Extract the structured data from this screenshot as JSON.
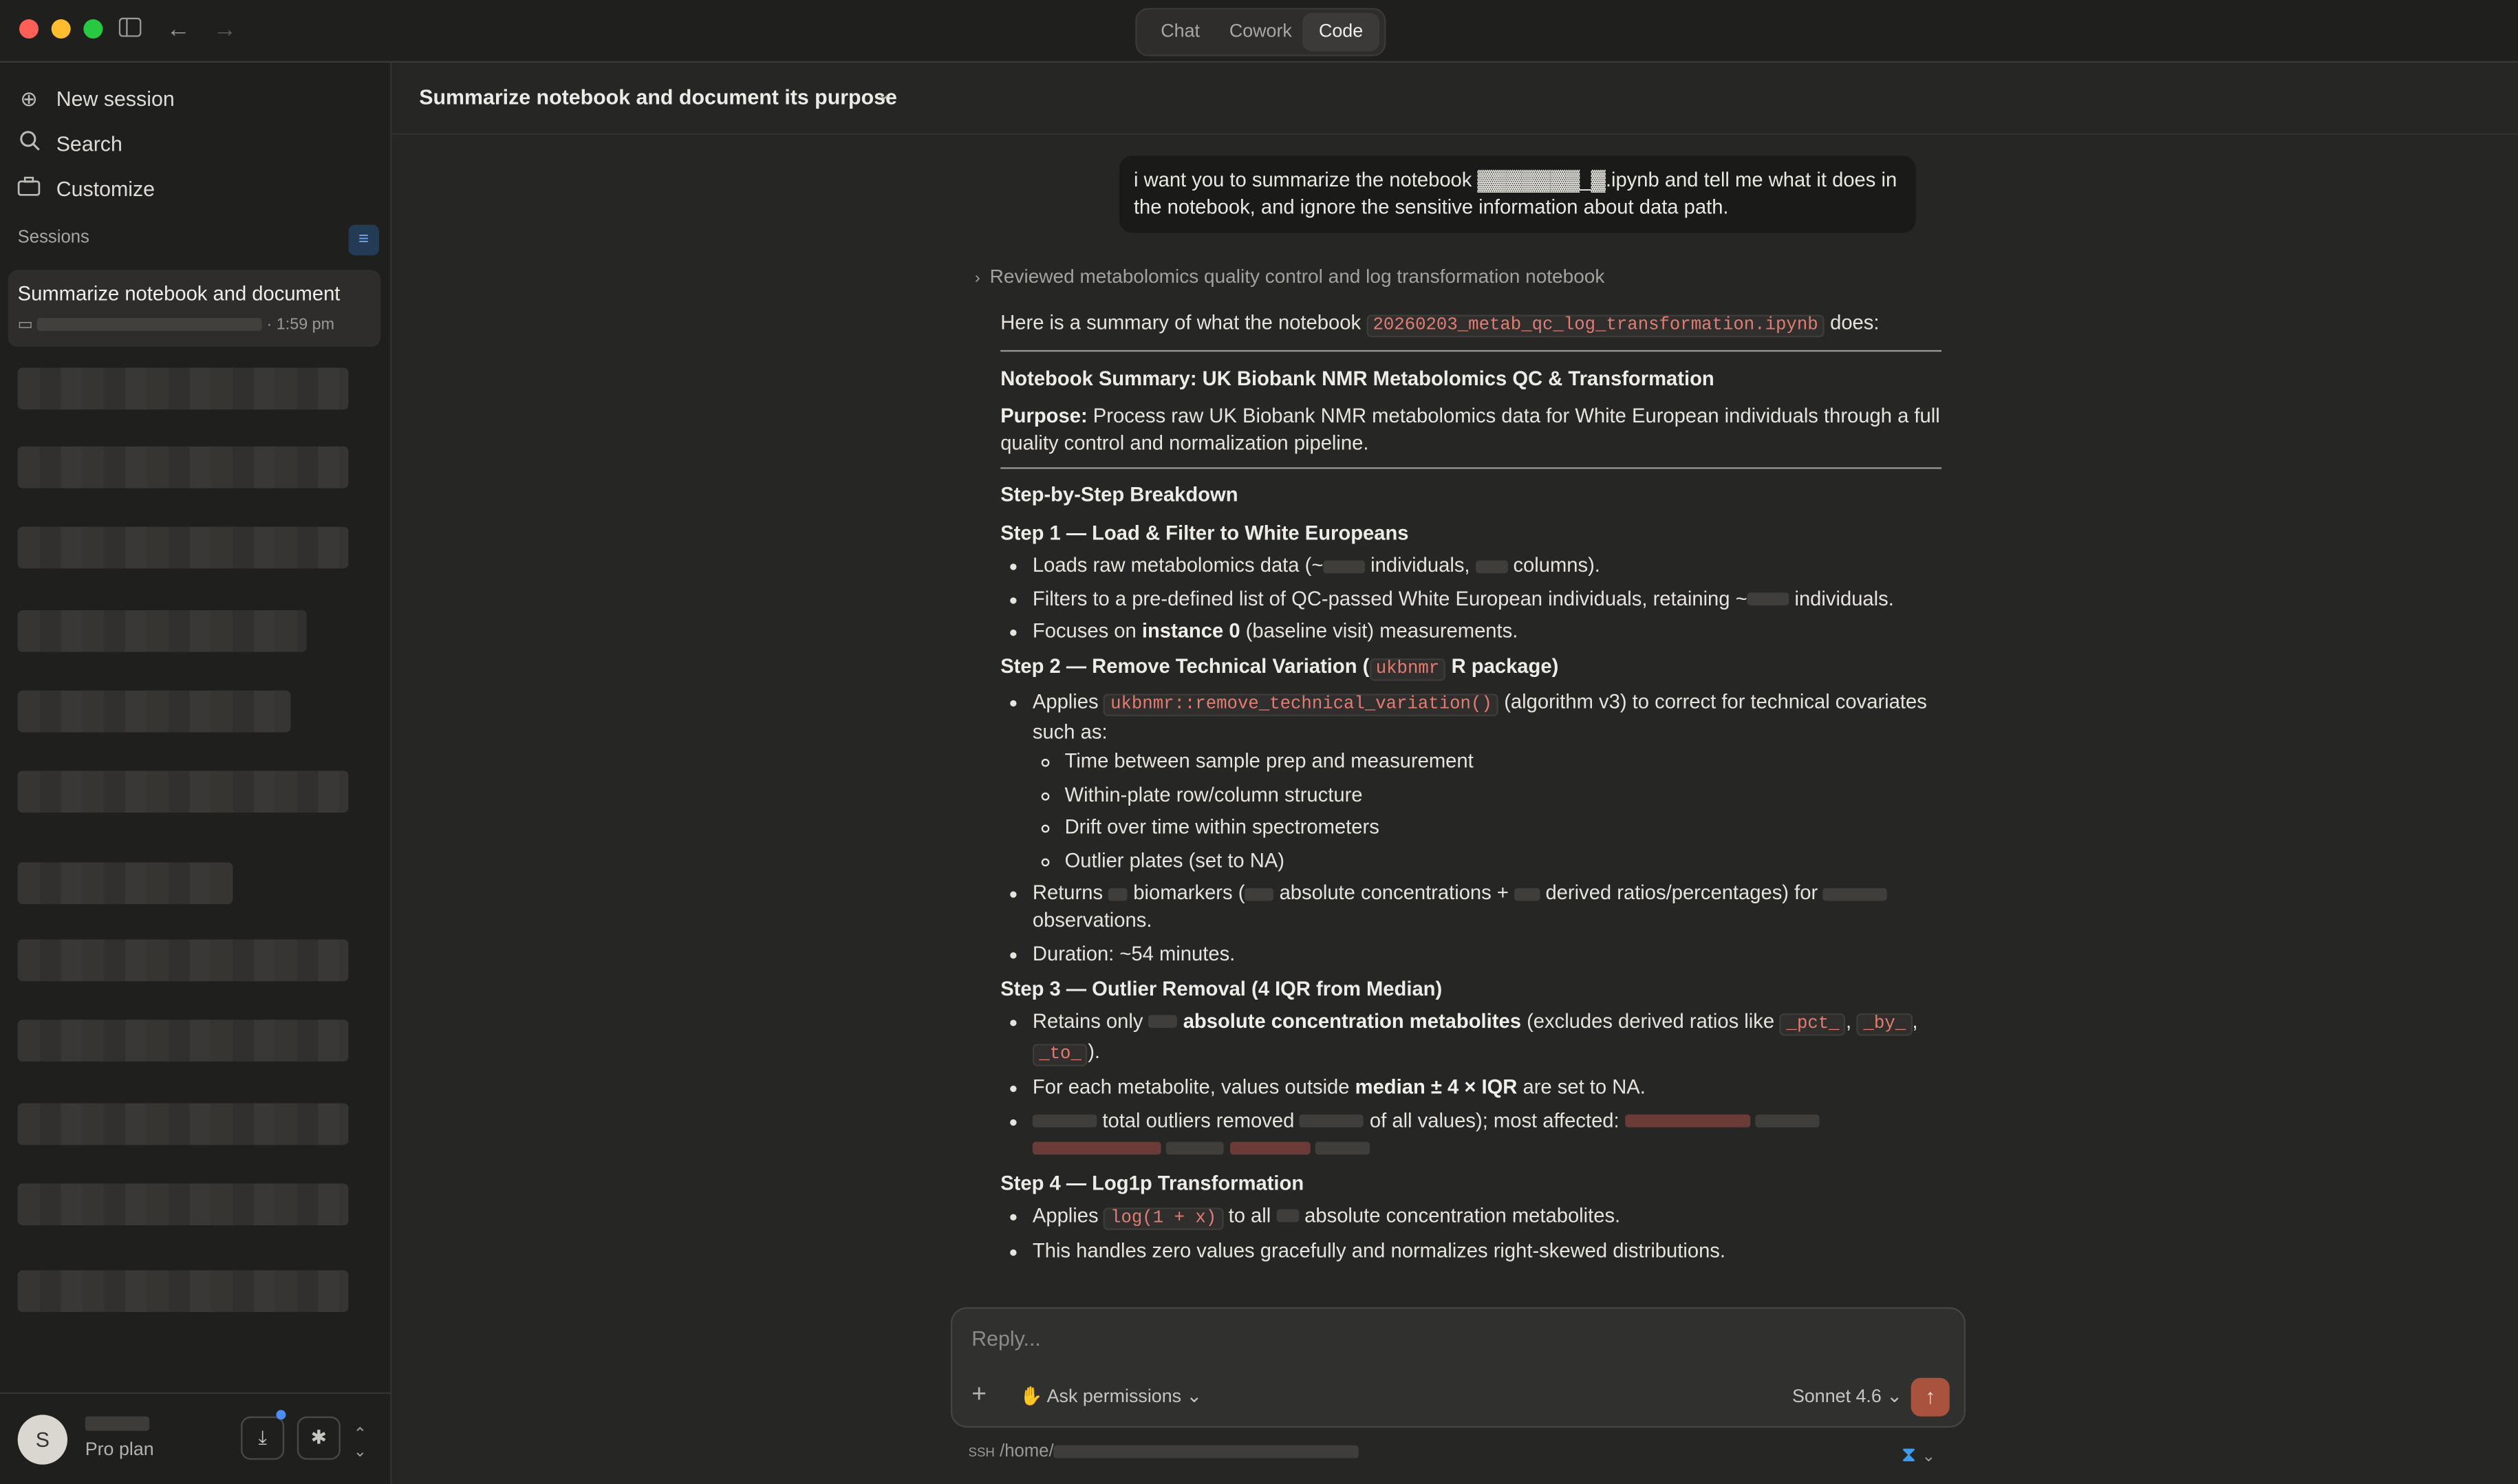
{
  "window": {
    "traffic_colors": [
      "#ff5f57",
      "#febc2e",
      "#28c840"
    ]
  },
  "modes": [
    {
      "label": "Chat"
    },
    {
      "label": "Cowork"
    },
    {
      "label": "Code"
    }
  ],
  "sidebar": {
    "new_session": "New session",
    "search": "Search",
    "customize": "Customize",
    "sessions_label": "Sessions",
    "active_session": {
      "title": "Summarize notebook and document",
      "time": "· 1:59 pm"
    },
    "user": {
      "initial": "S",
      "plan": "Pro plan"
    }
  },
  "main": {
    "heading": "Summarize notebook and document its purpose",
    "user_message": "i want you to summarize the notebook ▓▓▓▓▓▓▓_▓.ipynb and tell me what it does in the notebook, and ignore the sensitive information about data path.",
    "reviewed": "Reviewed metabolomics quality control and log transformation notebook",
    "response": {
      "intro_pre": "Here is a summary of what the notebook ",
      "intro_file": "20260203_metab_qc_log_transformation.ipynb",
      "intro_post": " does:",
      "title": "Notebook Summary: UK Biobank NMR Metabolomics QC & Transformation",
      "purpose_label": "Purpose:",
      "purpose_text": " Process raw UK Biobank NMR metabolomics data for White European individuals through a full quality control and normalization pipeline.",
      "breakdown": "Step-by-Step Breakdown",
      "step1": {
        "title": "Step 1 — Load & Filter to White Europeans",
        "b1_pre": "Loads raw metabolomics data (~",
        "b1_mid": " individuals, ",
        "b1_post": " columns).",
        "b2_pre": "Filters to a pre-defined list of QC-passed White European individuals, retaining ~",
        "b2_post": " individuals.",
        "b3_pre": "Focuses on ",
        "b3_bold": "instance 0",
        "b3_post": " (baseline visit) measurements."
      },
      "step2": {
        "title_pre": "Step 2 — Remove Technical Variation (",
        "title_code": "ukbnmr",
        "title_post": " R package)",
        "b1_pre": "Applies ",
        "b1_code": "ukbnmr::remove_technical_variation()",
        "b1_post": " (algorithm v3) to correct for technical covariates such as:",
        "sub": [
          "Time between sample prep and measurement",
          "Within-plate row/column structure",
          "Drift over time within spectrometers",
          "Outlier plates (set to NA)"
        ],
        "b2_pre": "Returns ",
        "b2_mid1": " biomarkers (",
        "b2_mid2": " absolute concentrations + ",
        "b2_mid3": " derived ratios/percentages) for ",
        "b2_post": " observations.",
        "b3": "Duration: ~54 minutes."
      },
      "step3": {
        "title": "Step 3 — Outlier Removal (4 IQR from Median)",
        "b1_pre": "Retains only ",
        "b1_bold": " absolute concentration metabolites",
        "b1_mid": " (excludes derived ratios like ",
        "c1": "_pct_",
        "c2": "_by_",
        "c3": "_to_",
        "sep": ", ",
        "b1_post": ").",
        "b2_pre": "For each metabolite, values outside ",
        "b2_bold": "median ± 4 × IQR",
        "b2_post": " are set to NA.",
        "b3_mid1": " total outliers removed ",
        "b3_mid2": " of all values); most affected: "
      },
      "step4": {
        "title": "Step 4 — Log1p Transformation",
        "b1_pre": "Applies ",
        "b1_code": "log(1 + x)",
        "b1_mid": " to all ",
        "b1_post": " absolute concentration metabolites.",
        "b2": "This handles zero values gracefully and normalizes right-skewed distributions."
      }
    }
  },
  "composer": {
    "placeholder": "Reply...",
    "permissions": "Ask permissions",
    "model": "Sonnet 4.6",
    "path_prefix": "SSH",
    "path": "/home/"
  },
  "colors": {
    "accent": "#a9533f",
    "code_text": "#e27d73",
    "link_blue": "#4c8ef5"
  }
}
